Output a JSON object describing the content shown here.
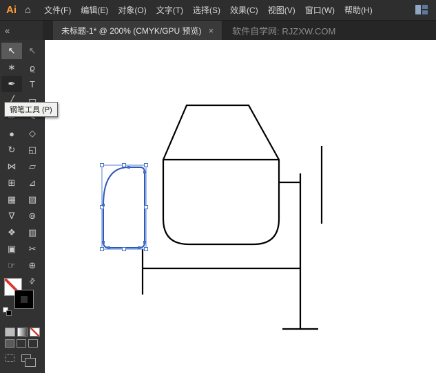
{
  "app": {
    "name_logo": "Ai",
    "home_icon": "⌂",
    "collapse_glyph": "«"
  },
  "menu_bar": {
    "items": [
      {
        "label": "文件(F)"
      },
      {
        "label": "编辑(E)"
      },
      {
        "label": "对象(O)"
      },
      {
        "label": "文字(T)"
      },
      {
        "label": "选择(S)"
      },
      {
        "label": "效果(C)"
      },
      {
        "label": "视图(V)"
      },
      {
        "label": "窗口(W)"
      },
      {
        "label": "帮助(H)"
      }
    ]
  },
  "tab_bar": {
    "document_title": "未标题-1* @ 200% (CMYK/GPU 预览)",
    "close_glyph": "×",
    "watermark": "软件自学网: RJZXW.COM"
  },
  "toolbar": {
    "tooltip": "钢笔工具 (P)",
    "fill": "none",
    "stroke": "#000000",
    "tools": [
      {
        "id": "selection",
        "glyph": "↖",
        "state": "active"
      },
      {
        "id": "direct-selection",
        "glyph": "↖"
      },
      {
        "id": "magic-wand",
        "glyph": "∗"
      },
      {
        "id": "lasso",
        "glyph": "ϱ"
      },
      {
        "id": "pen",
        "glyph": "✒",
        "state": "pressed"
      },
      {
        "id": "type",
        "glyph": "T"
      },
      {
        "id": "line-segment",
        "glyph": "╱"
      },
      {
        "id": "rectangle",
        "glyph": "▭"
      },
      {
        "id": "paintbrush",
        "glyph": "✑"
      },
      {
        "id": "pencil",
        "glyph": "✎"
      },
      {
        "id": "blob-brush",
        "glyph": "●"
      },
      {
        "id": "eraser",
        "glyph": "◇"
      },
      {
        "id": "rotate",
        "glyph": "↻"
      },
      {
        "id": "scale",
        "glyph": "◱"
      },
      {
        "id": "width",
        "glyph": "⋈"
      },
      {
        "id": "free-transform",
        "glyph": "▱"
      },
      {
        "id": "shape-builder",
        "glyph": "⊞"
      },
      {
        "id": "perspective-grid",
        "glyph": "⊿"
      },
      {
        "id": "mesh",
        "glyph": "▦"
      },
      {
        "id": "gradient",
        "glyph": "▨"
      },
      {
        "id": "eyedropper",
        "glyph": "∇"
      },
      {
        "id": "blend",
        "glyph": "⊚"
      },
      {
        "id": "symbol-sprayer",
        "glyph": "❖"
      },
      {
        "id": "column-graph",
        "glyph": "▥"
      },
      {
        "id": "artboard",
        "glyph": "▣"
      },
      {
        "id": "slice",
        "glyph": "✂"
      },
      {
        "id": "hand",
        "glyph": "☞"
      },
      {
        "id": "zoom",
        "glyph": "⊕"
      }
    ]
  },
  "canvas": {
    "artwork": "cement mixer line drawing, small hopper part selected",
    "stroke_color": "#000000",
    "selection_color": "#3E6FD0"
  },
  "colors": {
    "chrome": "#323232",
    "tab_bar": "#262626",
    "accent_selection": "#3E6FD0",
    "logo_amber": "#FF9A38",
    "none_slash_red": "#D93A2E"
  }
}
